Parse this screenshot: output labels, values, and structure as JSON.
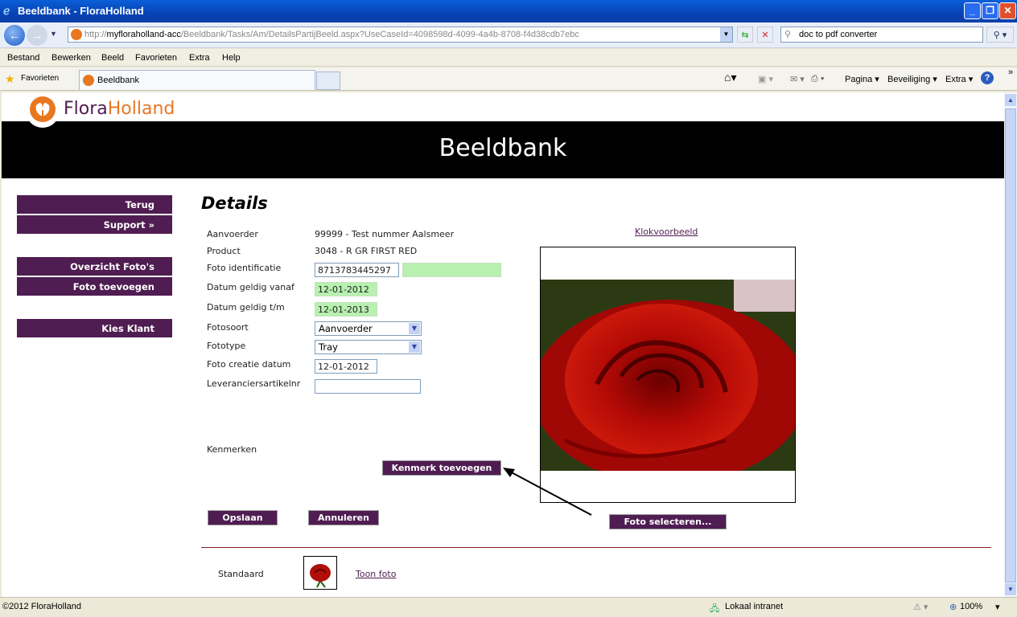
{
  "window": {
    "title": "Beeldbank - FloraHolland"
  },
  "address": {
    "url_prefix": "http://",
    "url_host": "myfloraholland-acc",
    "url_path": "/Beeldbank/Tasks/Am/DetailsPartijBeeld.aspx?UseCaseId=4098598d-4099-4a4b-8708-f4d38cdb7ebc",
    "search_value": "doc to pdf converter"
  },
  "menu": [
    "Bestand",
    "Bewerken",
    "Beeld",
    "Favorieten",
    "Extra",
    "Help"
  ],
  "favbar": {
    "favorites": "Favorieten",
    "tab": "Beeldbank",
    "commands": [
      "Pagina ▾",
      "Beveiliging ▾",
      "Extra ▾"
    ]
  },
  "page": {
    "logo": {
      "flora": "Flora",
      "holland": "Holland"
    },
    "banner": "Beeldbank",
    "sidebar": [
      "Terug",
      "Support  »",
      "Overzicht Foto's",
      "Foto toevoegen",
      "Kies Klant"
    ],
    "heading": "Details",
    "fields": {
      "aanvoerder_label": "Aanvoerder",
      "aanvoerder_value": "99999 - Test nummer Aalsmeer",
      "product_label": "Product",
      "product_value": "3048 - R GR FIRST RED",
      "foto_id_label": "Foto identificatie",
      "foto_id_value": "8713783445297",
      "foto_id_extra": "",
      "vanaf_label": "Datum geldig vanaf",
      "vanaf_value": "12-01-2012",
      "tm_label": "Datum geldig t/m",
      "tm_value": "12-01-2013",
      "fotosoort_label": "Fotosoort",
      "fotosoort_value": "Aanvoerder",
      "fototype_label": "Fototype",
      "fototype_value": "Tray",
      "creatie_label": "Foto creatie datum",
      "creatie_value": "12-01-2012",
      "lev_label": "Leveranciersartikelnr",
      "lev_value": ""
    },
    "kenmerken_label": "Kenmerken",
    "kenmerk_button": "Kenmerk toevoegen",
    "opslaan": "Opslaan",
    "annuleren": "Annuleren",
    "klokvoorbeeld": "Klokvoorbeeld",
    "foto_selecteren": "Foto selecteren...",
    "standaard": "Standaard",
    "toon_foto": "Toon foto",
    "accent": "#4f1d52"
  },
  "status": {
    "left": "©2012 FloraHolland",
    "zone": "Lokaal intranet",
    "zoom": "100%"
  }
}
